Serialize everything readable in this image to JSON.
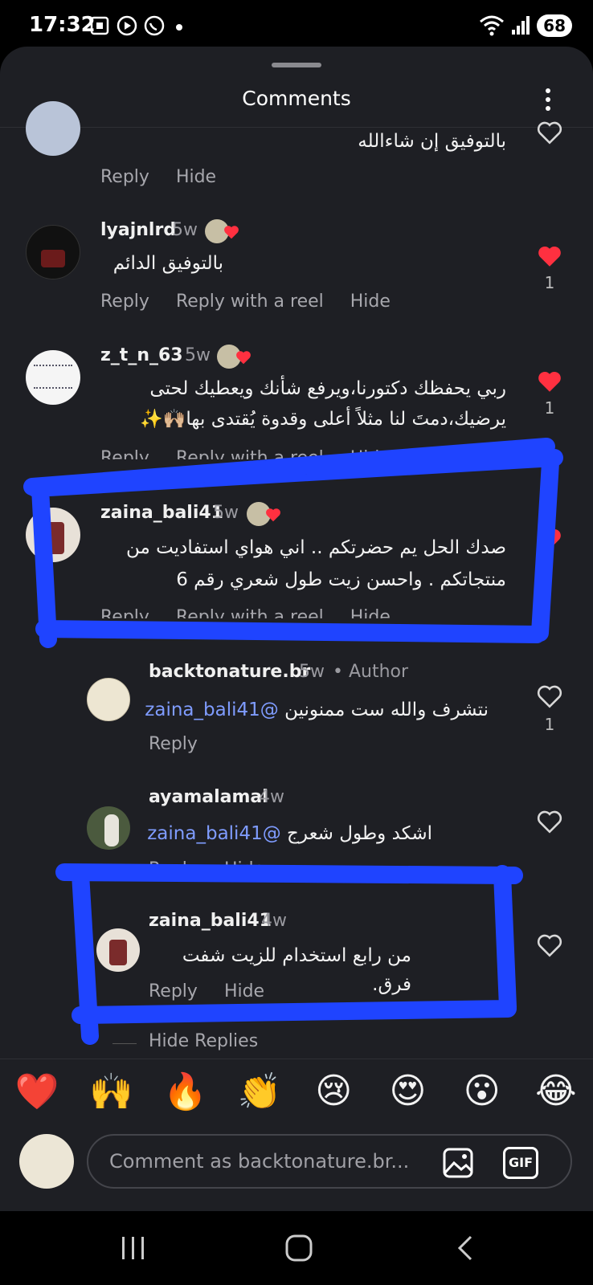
{
  "status_bar": {
    "time": "17:32",
    "battery": "68"
  },
  "sheet": {
    "title": "Comments"
  },
  "comments": [
    {
      "text": "بالتوفيق إن شاءالله",
      "actions": [
        "Reply",
        "Hide"
      ]
    },
    {
      "username": "lyajnlrd",
      "time": "5w",
      "text": "بالتوفيق الدائم",
      "actions": [
        "Reply",
        "Reply with a reel",
        "Hide"
      ],
      "like_count": "1"
    },
    {
      "username": "z_t_n_63",
      "time": "5w",
      "text_line1": "ربي يحفظك دكتورنا،ويرفع شأنك ويعطيك لحتى",
      "text_line2": "يرضيك،دمتَ لنا مثلاً أعلى  وقدوة يُقتدى بها🙌🏼✨",
      "actions": [
        "Reply",
        "Reply with a reel",
        "Hide"
      ],
      "like_count": "1"
    },
    {
      "username": "zaina_bali41",
      "time": "5w",
      "text_line1": "صدك الحل يم حضرتكم .. اني هواي استفاديت من",
      "text_line2": "منتجاتكم . واحسن زيت طول شعري رقم 6",
      "actions": [
        "Reply",
        "Reply with a reel",
        "Hide"
      ]
    },
    {
      "username": "backtonature.br",
      "time": "5w",
      "author_tag": "• Author",
      "mention": "@zaina_bali41",
      "text": "نتشرف والله ست ممنونين",
      "actions": [
        "Reply"
      ],
      "like_count": "1"
    },
    {
      "username": "ayamalamal",
      "time": "4w",
      "mention": "@zaina_bali41",
      "text": "اشكد وطول شعرج",
      "actions": [
        "Reply",
        "Hide"
      ]
    },
    {
      "username": "zaina_bali41",
      "time": "4w",
      "text": "من رابع استخدام للزيت شفت فرق.",
      "actions": [
        "Reply",
        "Hide"
      ]
    }
  ],
  "hide_replies": "Hide Replies",
  "emoji_bar": [
    "❤️",
    "🙌",
    "🔥",
    "👏",
    "😢",
    "😍",
    "😮",
    "😂"
  ],
  "composer": {
    "placeholder": "Comment as backtonature.br...",
    "gif_label": "GIF"
  },
  "colors": {
    "sheet_bg": "#1e1f24",
    "marker_blue": "#1f44ff",
    "like_red": "#ff3040",
    "mention": "#7f9cff"
  }
}
